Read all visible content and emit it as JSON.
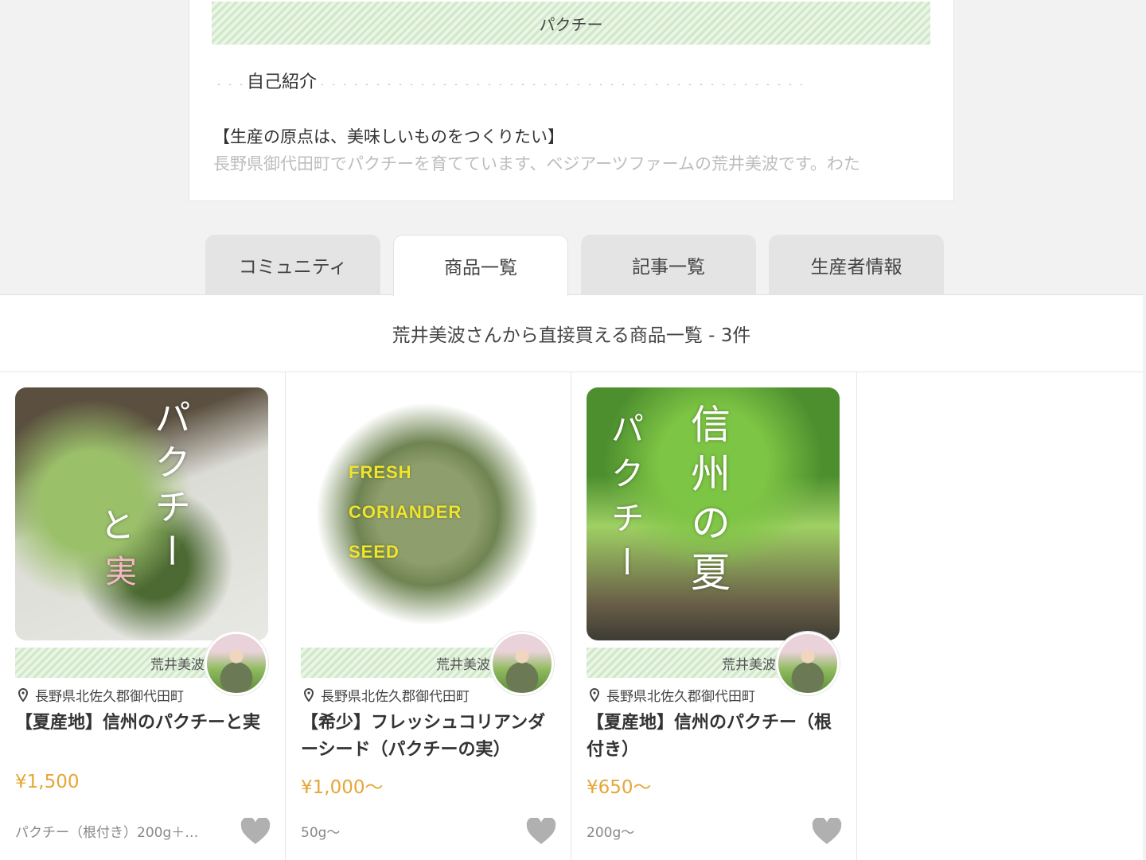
{
  "profile": {
    "tag": "パクチー",
    "intro_heading": "自己紹介",
    "intro_title": "【生産の原点は、美味しいものをつくりたい】",
    "intro_body": "長野県御代田町でパクチーを育てています、ベジアーツファームの荒井美波です。わた"
  },
  "tabs": [
    {
      "label": "コミュニティ",
      "active": false
    },
    {
      "label": "商品一覧",
      "active": true
    },
    {
      "label": "記事一覧",
      "active": false
    },
    {
      "label": "生産者情報",
      "active": false
    }
  ],
  "section": {
    "title": "荒井美波さんから直接買える商品一覧 - 3件"
  },
  "products": [
    {
      "image_text": [
        "パクチー",
        "と",
        "実"
      ],
      "producer": "荒井美波",
      "location": "長野県北佐久郡御代田町",
      "title": "【夏産地】信州のパクチーと実",
      "price": "¥1,500",
      "spec": "パクチー（根付き）200g＋…"
    },
    {
      "image_text": [
        "FRESH",
        "CORIANDER",
        "SEED"
      ],
      "producer": "荒井美波",
      "location": "長野県北佐久郡御代田町",
      "title": "【希少】フレッシュコリアンダーシード（パクチーの実）",
      "price": "¥1,000〜",
      "spec": "50g〜"
    },
    {
      "image_text": [
        "信州の夏",
        "パクチー"
      ],
      "producer": "荒井美波",
      "location": "長野県北佐久郡御代田町",
      "title": "【夏産地】信州のパクチー（根付き）",
      "price": "¥650〜",
      "spec": "200g〜"
    }
  ],
  "colors": {
    "price": "#e5a636",
    "stripe_green": "#cfe8c8",
    "heart": "#b0b0b0"
  }
}
